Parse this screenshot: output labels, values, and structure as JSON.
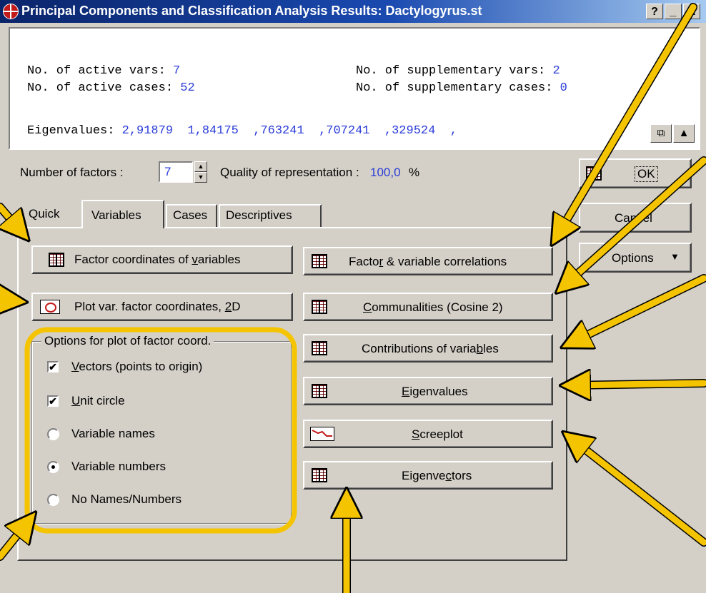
{
  "window": {
    "title": "Principal Components and Classification Analysis Results: Dactylogyrus.st",
    "help_btn": "?",
    "min_btn": "_",
    "close_btn": "X"
  },
  "summary": {
    "active_vars_label": "No. of active vars:",
    "active_vars_value": "7",
    "supp_vars_label": "No. of supplementary vars:",
    "supp_vars_value": "2",
    "active_cases_label": "No. of active cases:",
    "active_cases_value": "52",
    "supp_cases_label": "No. of supplementary cases:",
    "supp_cases_value": "0",
    "eigen_label": "Eigenvalues:",
    "eigen_values": "2,91879  1,84175  ,763241  ,707241  ,329524  ,"
  },
  "controls": {
    "num_factors_label": "Number of factors :",
    "num_factors_value": "7",
    "quality_label": "Quality of representation :",
    "quality_value": "100,0",
    "quality_unit": "%",
    "ok_label": "OK",
    "cancel_label": "Cancel",
    "options_label": "Options"
  },
  "tabs": [
    "Quick",
    "Variables",
    "Cases",
    "Descriptives"
  ],
  "left_buttons": {
    "factor_coords_pre": "Factor coordinates of ",
    "factor_coords_u": "v",
    "factor_coords_post": "ariables",
    "plot_pre": "Plot var. factor coordinates, ",
    "plot_u": "2",
    "plot_post": "D"
  },
  "options_group": {
    "title": "Options for plot of factor coord.",
    "vectors_u": "V",
    "vectors_rest": "ectors (points to origin)",
    "vectors_checked": true,
    "unit_u": "U",
    "unit_rest": "nit circle",
    "unit_checked": true,
    "radio_names": "Variable names",
    "radio_numbers": "Variable numbers",
    "radio_none": "No Names/Numbers",
    "selected": "Variable numbers"
  },
  "right_buttons": {
    "corr_pre": "Facto",
    "corr_u": "r",
    "corr_post": " & variable correlations",
    "comm_u": "C",
    "comm_rest": "ommunalities (Cosine 2)",
    "contrib_pre": "Contributions of varia",
    "contrib_u": "b",
    "contrib_post": "les",
    "eigen_u": "E",
    "eigen_rest": "igenvalues",
    "scree_u": "S",
    "scree_rest": "creeplot",
    "eigvec_pre": "Eigenve",
    "eigvec_u": "c",
    "eigvec_post": "tors"
  },
  "colors": {
    "accent_blue": "#2a3cd8",
    "highlight_yellow": "#f5c400",
    "titlebar": "#0a246a"
  }
}
